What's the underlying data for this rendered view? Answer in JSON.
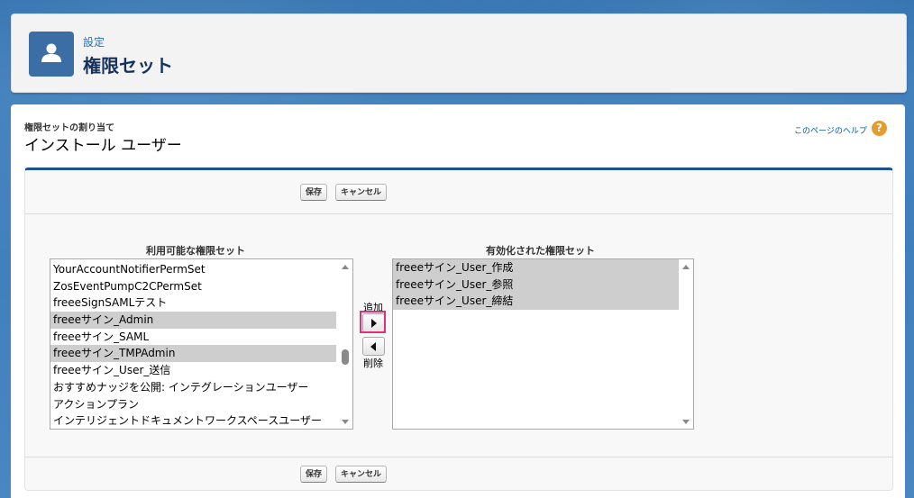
{
  "header": {
    "breadcrumb": "設定",
    "title": "権限セット"
  },
  "page": {
    "subtitle": "権限セットの割り当て",
    "name": "インストール ユーザー",
    "help_link": "このページのヘルプ",
    "help_icon": "?"
  },
  "buttons": {
    "save": "保存",
    "cancel": "キャンセル"
  },
  "available": {
    "label": "利用可能な権限セット",
    "items": [
      "YourAccountNotifierPermSet",
      "ZosEventPumpC2CPermSet",
      "freeeSignSAMLテスト",
      "freeeサイン_Admin",
      "freeeサイン_SAML",
      "freeeサイン_TMPAdmin",
      "freeeサイン_User_送信",
      "おすすめナッジを公開: インテグレーションユーザー",
      "アクションプラン",
      "インテリジェントドキュメントワークスペースユーザー"
    ]
  },
  "enabled": {
    "label": "有効化された権限セット",
    "items": [
      "freeeサイン_User_作成",
      "freeeサイン_User_参照",
      "freeeサイン_User_締結"
    ]
  },
  "move": {
    "add": "追加",
    "remove": "削除"
  }
}
